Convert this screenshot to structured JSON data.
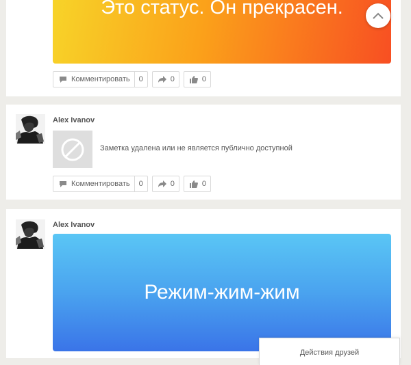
{
  "posts": [
    {
      "status_text": "Это статус. Он прекрасен.",
      "actions": {
        "comment_label": "Комментировать",
        "comment_count": "0",
        "share_count": "0",
        "like_count": "0"
      }
    },
    {
      "author": "Alex Ivanov",
      "deleted_text": "Заметка удалена или не является публично доступной",
      "actions": {
        "comment_label": "Комментировать",
        "comment_count": "0",
        "share_count": "0",
        "like_count": "0"
      }
    },
    {
      "author": "Alex Ivanov",
      "status_text": "Режим-жим-жим"
    }
  ],
  "friends_panel": {
    "label": "Действия друзей"
  },
  "colors": {
    "status1_gradient": [
      "#f7d529",
      "#fba11a",
      "#f84f22"
    ],
    "status2_gradient": [
      "#5ac6f5",
      "#3a74e8"
    ]
  }
}
